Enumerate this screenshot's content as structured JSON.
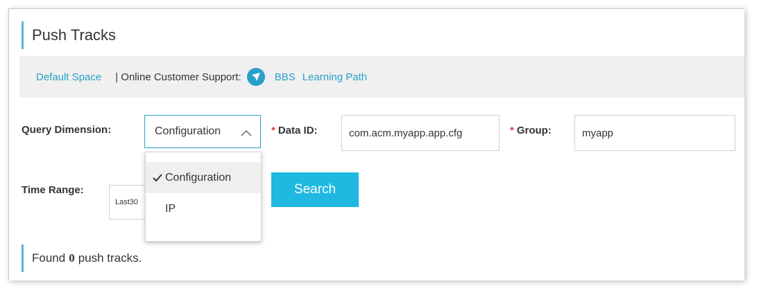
{
  "page": {
    "title": "Push Tracks"
  },
  "links": {
    "default_space": "Default Space",
    "separator": "| Online Customer Support:",
    "support_icon": "chat-bubble-icon",
    "bbs": "BBS",
    "learning_path": "Learning Path"
  },
  "form": {
    "query_dimension_label": "Query Dimension:",
    "query_dimension_value": "Configuration",
    "data_id_label": "Data ID:",
    "data_id_value": "com.acm.myapp.app.cfg",
    "group_label": "Group:",
    "group_value": "myapp",
    "required_mark": "*",
    "time_range_label": "Time Range:",
    "time_range_value": "Last30",
    "search_label": "Search"
  },
  "dropdown": {
    "options": [
      {
        "label": "Configuration",
        "selected": true
      },
      {
        "label": "IP",
        "selected": false
      }
    ]
  },
  "result": {
    "prefix": "Found",
    "count": "0",
    "suffix": "push tracks."
  },
  "colors": {
    "accent": "#29a0c9",
    "button": "#1eb8e0",
    "required": "#e23a3a",
    "bar_bg": "#f0f0f0"
  }
}
